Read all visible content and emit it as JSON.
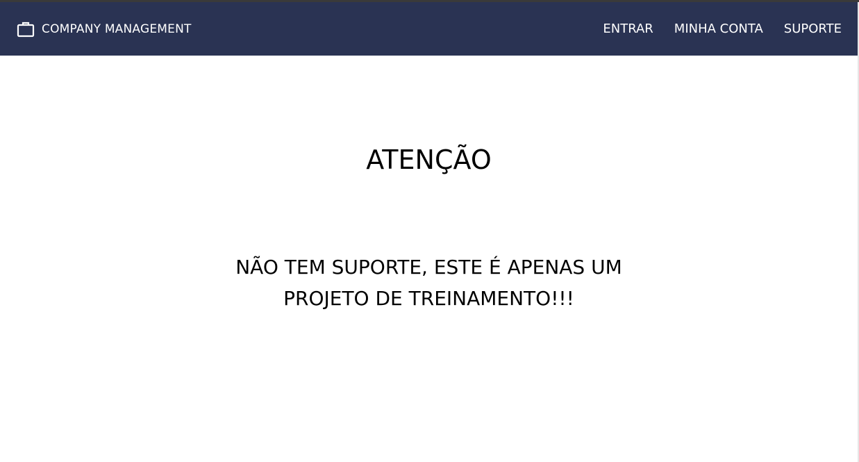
{
  "navbar": {
    "brand_icon": "briefcase-icon",
    "brand_label": "COMPANY MANAGEMENT",
    "links": [
      {
        "label": "ENTRAR"
      },
      {
        "label": "MINHA CONTA"
      },
      {
        "label": "SUPORTE"
      }
    ],
    "background_color": "#2a3353"
  },
  "main": {
    "title": "ATENÇÃO",
    "message_lines": [
      "NÃO TEM SUPORTE, ESTE É APENAS UM",
      "PROJETO DE TREINAMENTO!!!"
    ]
  }
}
